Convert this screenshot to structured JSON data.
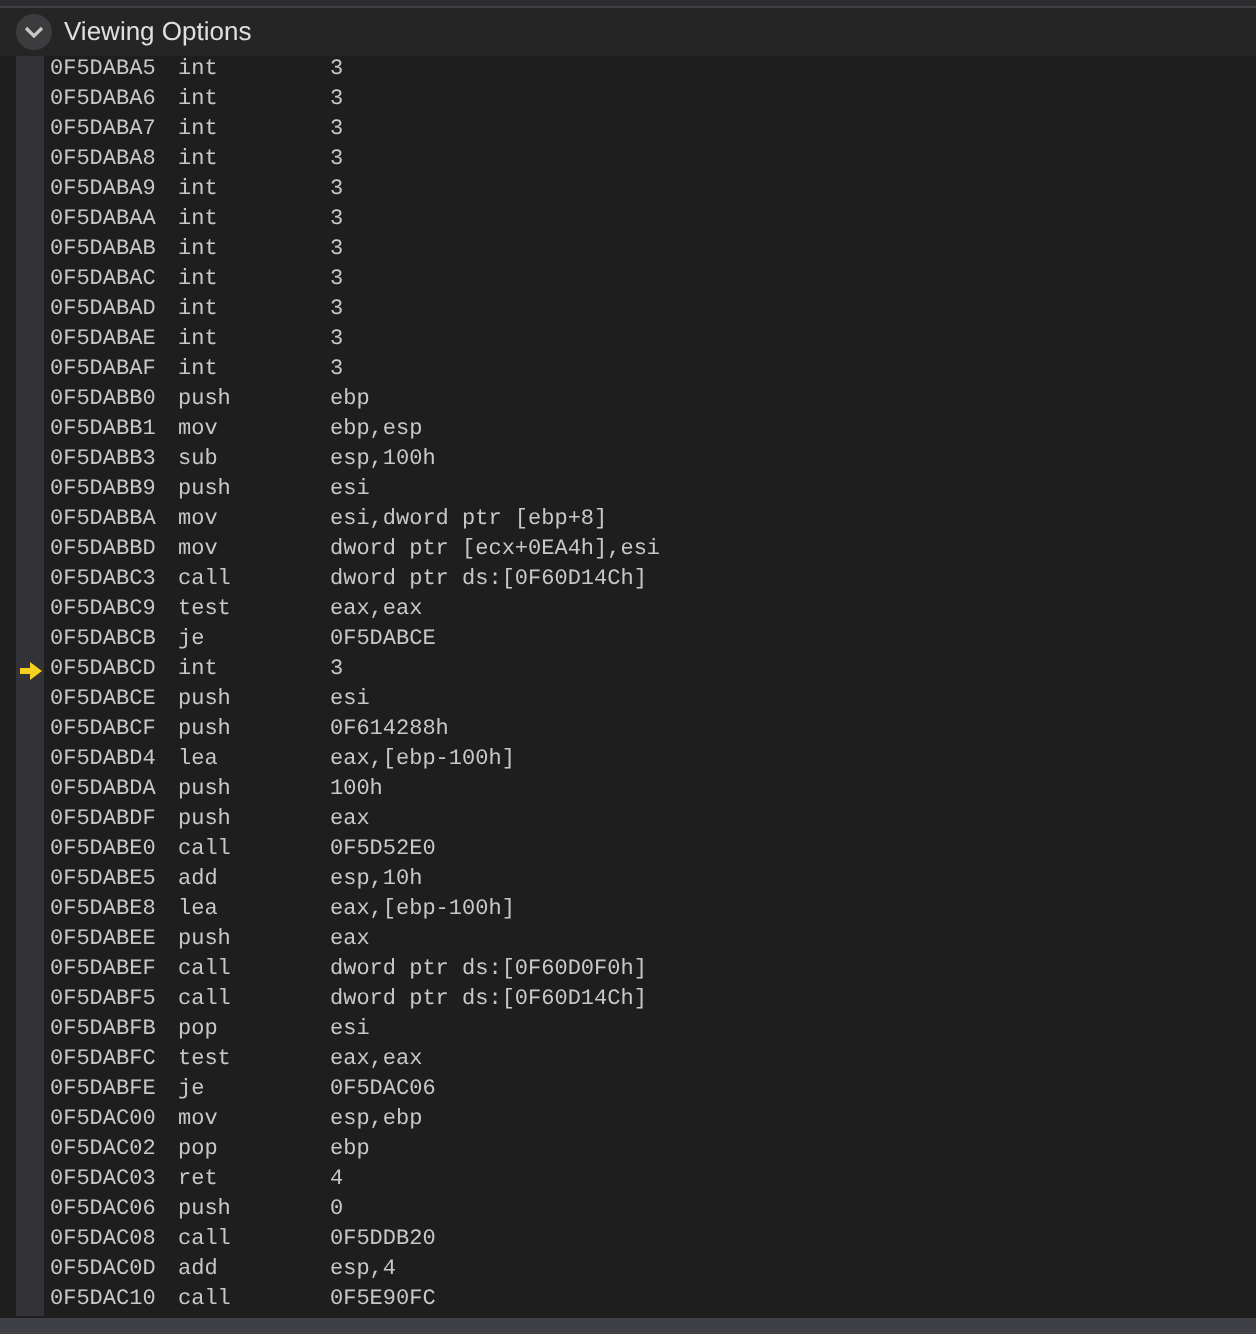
{
  "panel": {
    "title": "Viewing Options",
    "expanded": true
  },
  "rows": [
    {
      "address": "0F5DABA5",
      "mnemonic": "int",
      "operands": "3",
      "current": false
    },
    {
      "address": "0F5DABA6",
      "mnemonic": "int",
      "operands": "3",
      "current": false
    },
    {
      "address": "0F5DABA7",
      "mnemonic": "int",
      "operands": "3",
      "current": false
    },
    {
      "address": "0F5DABA8",
      "mnemonic": "int",
      "operands": "3",
      "current": false
    },
    {
      "address": "0F5DABA9",
      "mnemonic": "int",
      "operands": "3",
      "current": false
    },
    {
      "address": "0F5DABAA",
      "mnemonic": "int",
      "operands": "3",
      "current": false
    },
    {
      "address": "0F5DABAB",
      "mnemonic": "int",
      "operands": "3",
      "current": false
    },
    {
      "address": "0F5DABAC",
      "mnemonic": "int",
      "operands": "3",
      "current": false
    },
    {
      "address": "0F5DABAD",
      "mnemonic": "int",
      "operands": "3",
      "current": false
    },
    {
      "address": "0F5DABAE",
      "mnemonic": "int",
      "operands": "3",
      "current": false
    },
    {
      "address": "0F5DABAF",
      "mnemonic": "int",
      "operands": "3",
      "current": false
    },
    {
      "address": "0F5DABB0",
      "mnemonic": "push",
      "operands": "ebp",
      "current": false
    },
    {
      "address": "0F5DABB1",
      "mnemonic": "mov",
      "operands": "ebp,esp",
      "current": false
    },
    {
      "address": "0F5DABB3",
      "mnemonic": "sub",
      "operands": "esp,100h",
      "current": false
    },
    {
      "address": "0F5DABB9",
      "mnemonic": "push",
      "operands": "esi",
      "current": false
    },
    {
      "address": "0F5DABBA",
      "mnemonic": "mov",
      "operands": "esi,dword ptr [ebp+8]",
      "current": false
    },
    {
      "address": "0F5DABBD",
      "mnemonic": "mov",
      "operands": "dword ptr [ecx+0EA4h],esi",
      "current": false
    },
    {
      "address": "0F5DABC3",
      "mnemonic": "call",
      "operands": "dword ptr ds:[0F60D14Ch]",
      "current": false
    },
    {
      "address": "0F5DABC9",
      "mnemonic": "test",
      "operands": "eax,eax",
      "current": false
    },
    {
      "address": "0F5DABCB",
      "mnemonic": "je",
      "operands": "0F5DABCE",
      "current": false
    },
    {
      "address": "0F5DABCD",
      "mnemonic": "int",
      "operands": "3",
      "current": true
    },
    {
      "address": "0F5DABCE",
      "mnemonic": "push",
      "operands": "esi",
      "current": false
    },
    {
      "address": "0F5DABCF",
      "mnemonic": "push",
      "operands": "0F614288h",
      "current": false
    },
    {
      "address": "0F5DABD4",
      "mnemonic": "lea",
      "operands": "eax,[ebp-100h]",
      "current": false
    },
    {
      "address": "0F5DABDA",
      "mnemonic": "push",
      "operands": "100h",
      "current": false
    },
    {
      "address": "0F5DABDF",
      "mnemonic": "push",
      "operands": "eax",
      "current": false
    },
    {
      "address": "0F5DABE0",
      "mnemonic": "call",
      "operands": "0F5D52E0",
      "current": false
    },
    {
      "address": "0F5DABE5",
      "mnemonic": "add",
      "operands": "esp,10h",
      "current": false
    },
    {
      "address": "0F5DABE8",
      "mnemonic": "lea",
      "operands": "eax,[ebp-100h]",
      "current": false
    },
    {
      "address": "0F5DABEE",
      "mnemonic": "push",
      "operands": "eax",
      "current": false
    },
    {
      "address": "0F5DABEF",
      "mnemonic": "call",
      "operands": "dword ptr ds:[0F60D0F0h]",
      "current": false
    },
    {
      "address": "0F5DABF5",
      "mnemonic": "call",
      "operands": "dword ptr ds:[0F60D14Ch]",
      "current": false
    },
    {
      "address": "0F5DABFB",
      "mnemonic": "pop",
      "operands": "esi",
      "current": false
    },
    {
      "address": "0F5DABFC",
      "mnemonic": "test",
      "operands": "eax,eax",
      "current": false
    },
    {
      "address": "0F5DABFE",
      "mnemonic": "je",
      "operands": "0F5DAC06",
      "current": false
    },
    {
      "address": "0F5DAC00",
      "mnemonic": "mov",
      "operands": "esp,ebp",
      "current": false
    },
    {
      "address": "0F5DAC02",
      "mnemonic": "pop",
      "operands": "ebp",
      "current": false
    },
    {
      "address": "0F5DAC03",
      "mnemonic": "ret",
      "operands": "4",
      "current": false
    },
    {
      "address": "0F5DAC06",
      "mnemonic": "push",
      "operands": "0",
      "current": false
    },
    {
      "address": "0F5DAC08",
      "mnemonic": "call",
      "operands": "0F5DDB20",
      "current": false
    },
    {
      "address": "0F5DAC0D",
      "mnemonic": "add",
      "operands": "esp,4",
      "current": false
    },
    {
      "address": "0F5DAC10",
      "mnemonic": "call",
      "operands": "0F5E90FC",
      "current": false
    }
  ]
}
